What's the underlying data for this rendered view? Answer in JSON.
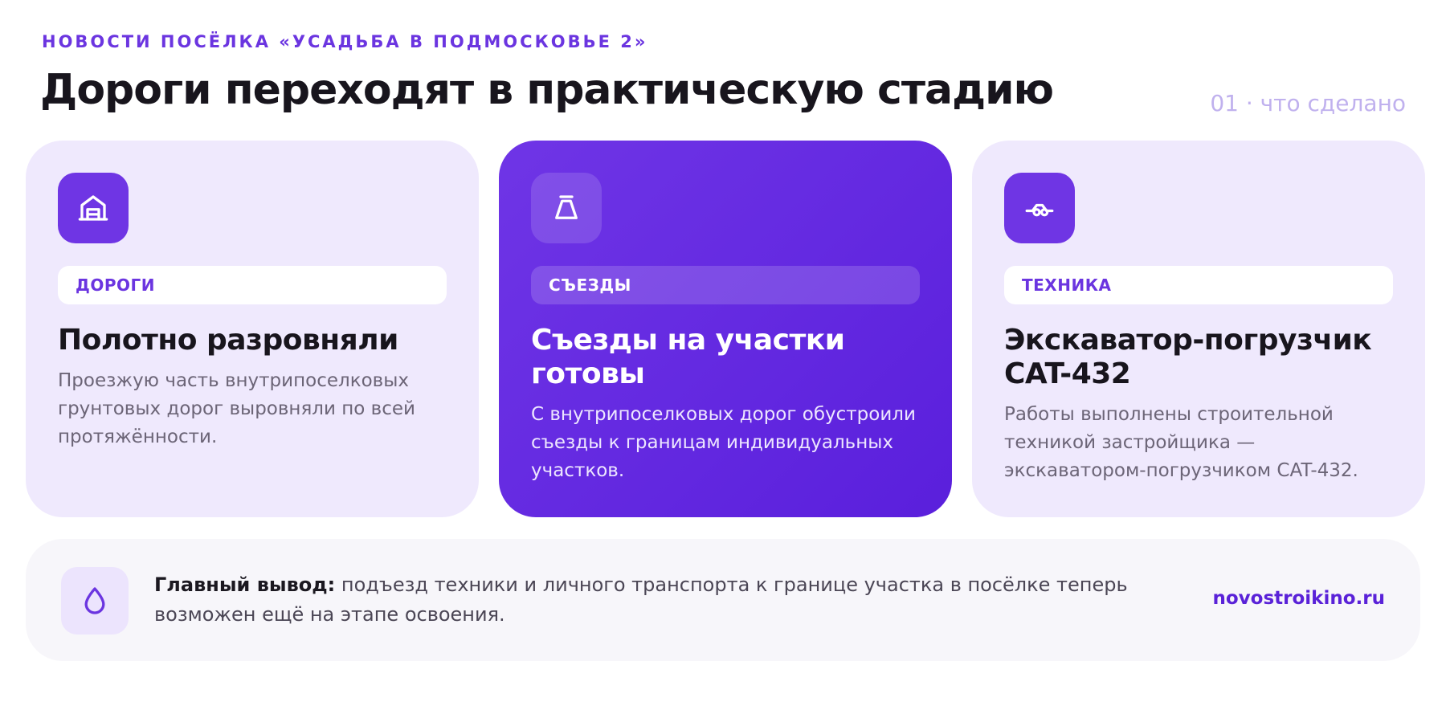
{
  "header": {
    "eyebrow": "НОВОСТИ ПОСЁЛКА «УСАДЬБА В ПОДМОСКОВЬЕ 2»",
    "title": "Дороги переходят в практическую стадию",
    "counter": "01 · что сделано"
  },
  "cards": [
    {
      "icon": "garage-icon",
      "tag": "ДОРОГИ",
      "title": "Полотно разровняли",
      "text": "Проезжую часть внутрипоселковых грунтовых дорог выровняли по всей протяжённости."
    },
    {
      "icon": "bucket-icon",
      "tag": "СЪЕЗДЫ",
      "title": "Съезды на участки готовы",
      "text": "С внутрипоселковых дорог обустроили съезды к границам индивидуальных участков."
    },
    {
      "icon": "excavator-icon",
      "tag": "ТЕХНИКА",
      "title": "Экскаватор-погрузчик CAT-432",
      "text": "Работы выполнены строительной техникой застройщика — экскаватором-погрузчиком CAT-432."
    }
  ],
  "summary": {
    "icon": "drop-icon",
    "label": "Главный вывод:",
    "text": " подъезд техники и личного транспорта к границе участка в посёлке теперь возможен ещё на этапе освоения.",
    "link": "novostroikino.ru"
  },
  "colors": {
    "accent": "#6b35e0",
    "card_bg": "#efe9fd",
    "highlight_card": "#5f25de",
    "summary_bg": "#f7f6fa"
  }
}
